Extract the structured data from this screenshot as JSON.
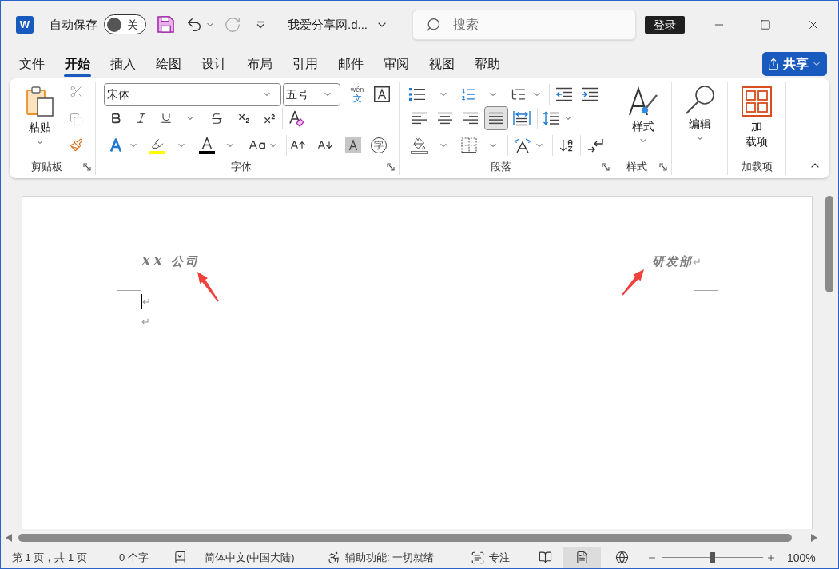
{
  "title_bar": {
    "app_logo": "W",
    "autosave": {
      "label": "自动保存",
      "on": false,
      "state_text": "关"
    },
    "redo": {
      "disabled": true
    },
    "document_title": "我爱分享网.d...",
    "search": {
      "placeholder": "搜索"
    },
    "sign_in": "登录"
  },
  "ribbon_tabs": [
    {
      "label": "文件",
      "selected": false
    },
    {
      "label": "开始",
      "selected": true
    },
    {
      "label": "插入",
      "selected": false
    },
    {
      "label": "绘图",
      "selected": false
    },
    {
      "label": "设计",
      "selected": false
    },
    {
      "label": "布局",
      "selected": false
    },
    {
      "label": "引用",
      "selected": false
    },
    {
      "label": "邮件",
      "selected": false
    },
    {
      "label": "审阅",
      "selected": false
    },
    {
      "label": "视图",
      "selected": false
    },
    {
      "label": "帮助",
      "selected": false
    }
  ],
  "share_button": "共享",
  "ribbon": {
    "clipboard": {
      "paste": "粘贴",
      "cut": {
        "disabled": true
      },
      "copy": {
        "disabled": true
      },
      "group_label": "剪贴板"
    },
    "font": {
      "font_name": "宋体",
      "font_size": "五号",
      "phonetic_guide": {
        "top": "wén",
        "bottom": "文"
      },
      "enclose_character": "字",
      "group_label": "字体"
    },
    "paragraph": {
      "alignment": [
        {
          "kind": "left",
          "selected": false
        },
        {
          "kind": "center",
          "selected": false
        },
        {
          "kind": "right",
          "selected": false
        },
        {
          "kind": "justify",
          "selected": true
        },
        {
          "kind": "distributed",
          "selected": false
        }
      ],
      "group_label": "段落"
    },
    "styles": {
      "button": "样式",
      "group_label": "样式"
    },
    "editing": {
      "button": "编辑"
    },
    "add_ins": {
      "button_lines": [
        "加",
        "载项"
      ],
      "group_label": "加载项"
    }
  },
  "document": {
    "header_left": "XX 公司",
    "header_right": "研发部",
    "header_right_mark": "↵",
    "body_marks": [
      "↵",
      "↵"
    ]
  },
  "status_bar": {
    "page_info": "第 1 页，共 1 页",
    "word_count": "0 个字",
    "language": "简体中文(中国大陆)",
    "accessibility": "辅助功能: 一切就绪",
    "focus": "专注",
    "views": [
      {
        "kind": "read",
        "selected": false
      },
      {
        "kind": "print",
        "selected": true
      },
      {
        "kind": "web",
        "selected": false
      }
    ],
    "zoom": {
      "level": 0.5,
      "reading": "100%"
    }
  }
}
